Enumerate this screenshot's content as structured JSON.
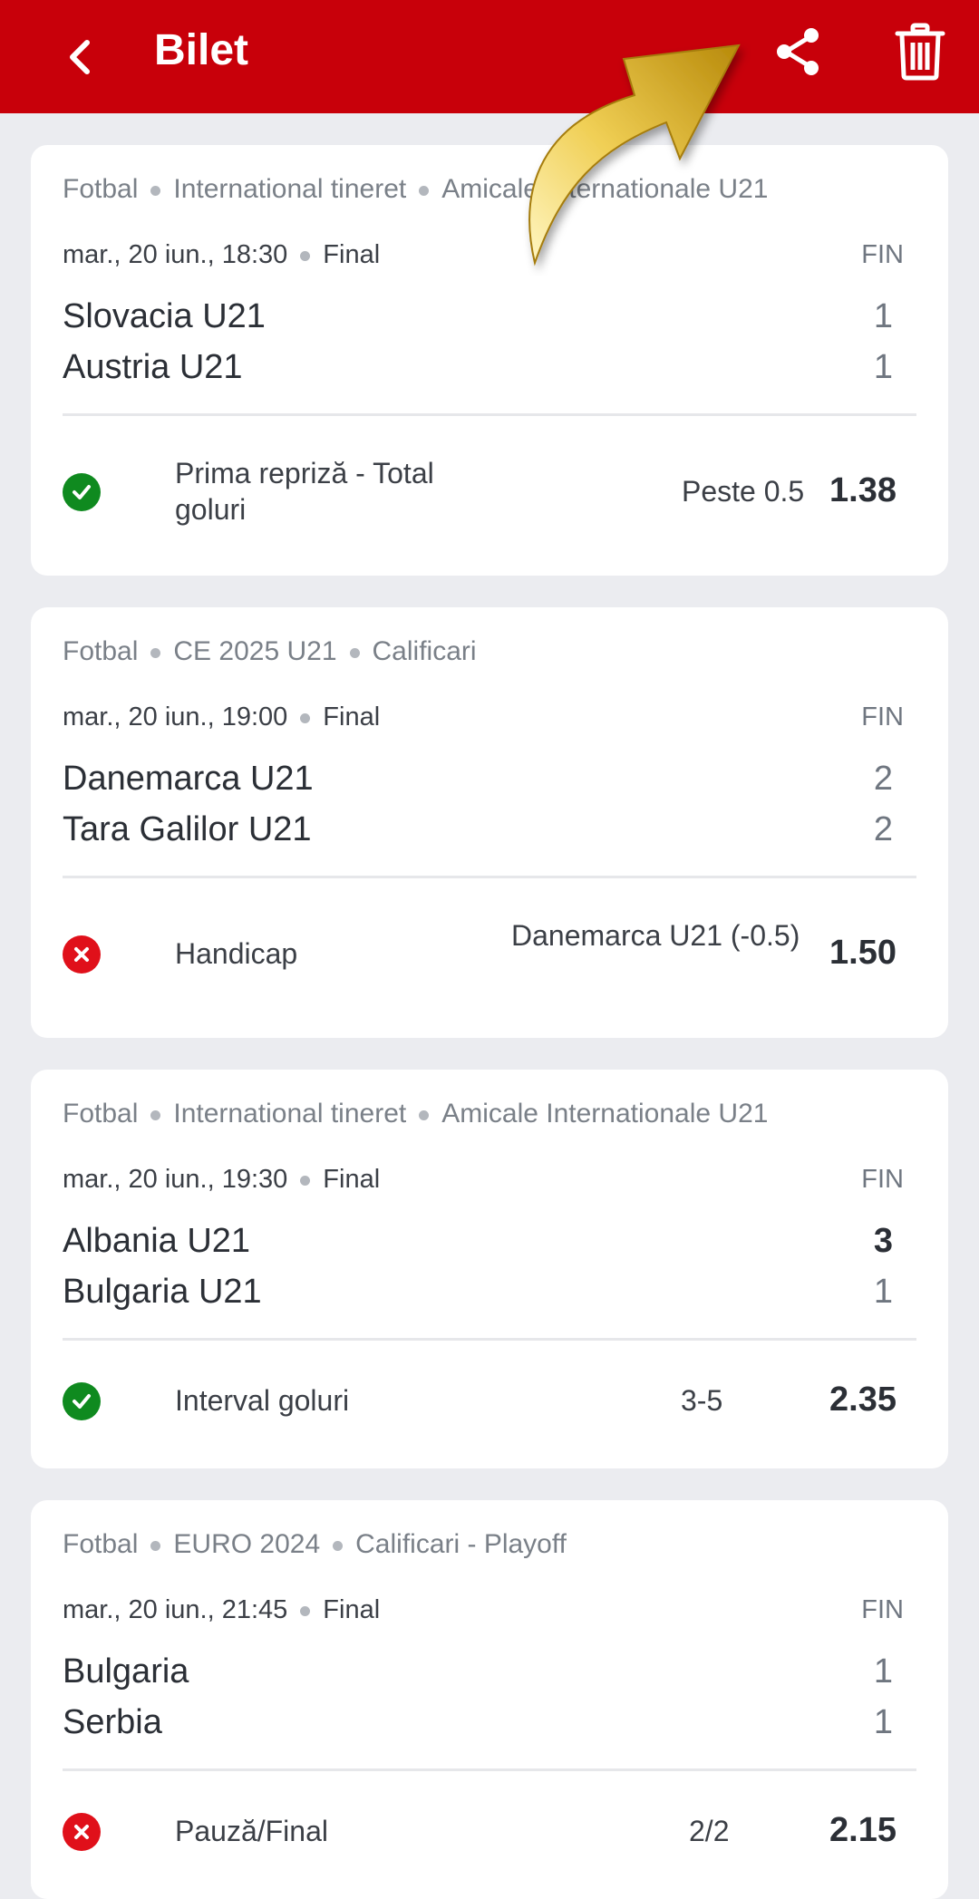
{
  "header": {
    "title": "Bilet"
  },
  "colors": {
    "brand": "#c8000a",
    "won": "#0f8a1f",
    "lost": "#e0101a"
  },
  "icons": {
    "back": "chevron-left-icon",
    "share": "share-icon",
    "delete": "trash-icon",
    "won": "check-icon",
    "lost": "cross-icon"
  },
  "events": [
    {
      "sport": "Fotbal",
      "category": "International tineret",
      "tournament": "Amicale Internationale U21",
      "datetime": "mar., 20 iun., 18:30",
      "phase": "Final",
      "status": "FIN",
      "home": "Slovacia U21",
      "home_score": "1",
      "away": "Austria U21",
      "away_score": "1",
      "market": "Prima repriză - Total goluri",
      "pick": "Peste 0.5",
      "odds": "1.38",
      "result": "won"
    },
    {
      "sport": "Fotbal",
      "category": "CE 2025 U21",
      "tournament": "Calificari",
      "datetime": "mar., 20 iun., 19:00",
      "phase": "Final",
      "status": "FIN",
      "home": "Danemarca U21",
      "home_score": "2",
      "away": "Tara Galilor U21",
      "away_score": "2",
      "market": "Handicap",
      "pick": "Danemarca U21 (-0.5)",
      "odds": "1.50",
      "result": "lost"
    },
    {
      "sport": "Fotbal",
      "category": "International tineret",
      "tournament": "Amicale Internationale U21",
      "datetime": "mar., 20 iun., 19:30",
      "phase": "Final",
      "status": "FIN",
      "home": "Albania U21",
      "home_score": "3",
      "away": "Bulgaria U21",
      "away_score": "1",
      "market": "Interval goluri",
      "pick": "3-5",
      "odds": "2.35",
      "result": "won"
    },
    {
      "sport": "Fotbal",
      "category": "EURO 2024",
      "tournament": "Calificari - Playoff",
      "datetime": "mar., 20 iun., 21:45",
      "phase": "Final",
      "status": "FIN",
      "home": "Bulgaria",
      "home_score": "1",
      "away": "Serbia",
      "away_score": "1",
      "market": "Pauză/Final",
      "pick": "2/2",
      "odds": "2.15",
      "result": "lost"
    }
  ]
}
